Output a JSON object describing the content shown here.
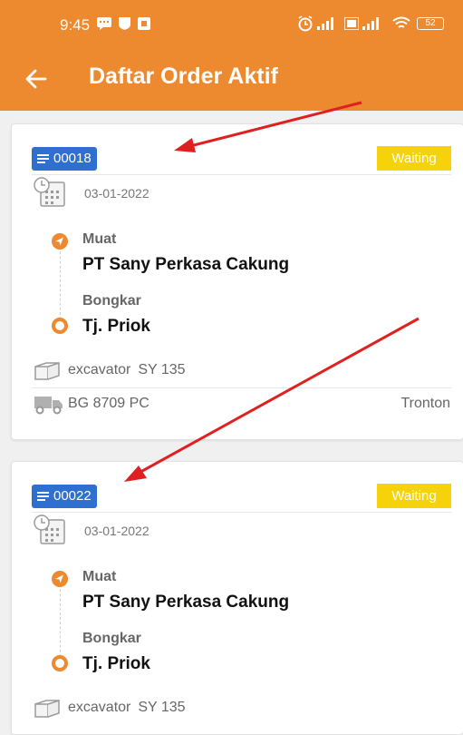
{
  "status_bar": {
    "time": "9:45",
    "battery": "52"
  },
  "toolbar": {
    "title": "Daftar Order Aktif",
    "back_icon": "arrow-left-icon"
  },
  "colors": {
    "app_bar": "#ed8a2f",
    "order_badge": "#2f6fd0",
    "status_badge": "#f5d20a",
    "route_marker": "#ed8a2f",
    "annotation_arrow": "#e02020"
  },
  "orders": [
    {
      "order_id": "00018",
      "status": "Waiting",
      "date": "03-01-2022",
      "muat_label": "Muat",
      "muat_place": "PT Sany Perkasa Cakung",
      "bongkar_label": "Bongkar",
      "bongkar_place": "Tj. Priok",
      "cargo_name": "excavator",
      "cargo_model": "SY 135",
      "vehicle_plate": "BG 8709 PC",
      "vehicle_type": "Tronton"
    },
    {
      "order_id": "00022",
      "status": "Waiting",
      "date": "03-01-2022",
      "muat_label": "Muat",
      "muat_place": "PT Sany Perkasa Cakung",
      "bongkar_label": "Bongkar",
      "bongkar_place": "Tj. Priok",
      "cargo_name": "excavator",
      "cargo_model": "SY 135"
    }
  ]
}
